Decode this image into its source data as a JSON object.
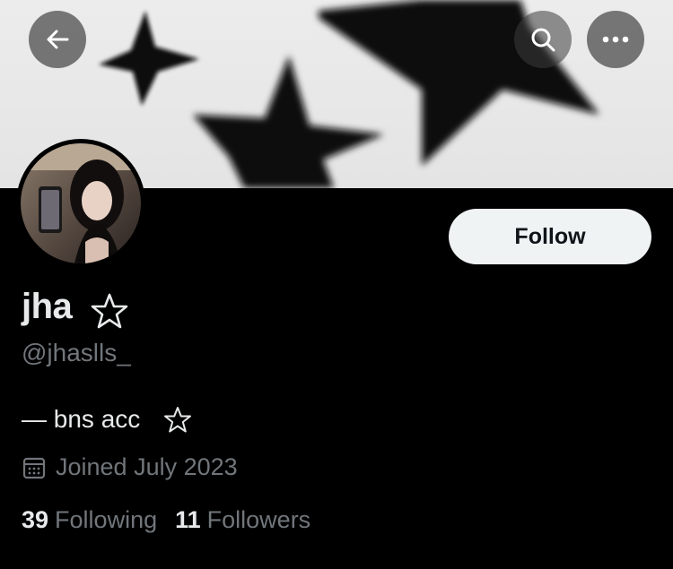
{
  "header": {
    "back_icon": "arrow-left-icon",
    "search_icon": "search-icon",
    "more_icon": "more-horizontal-icon"
  },
  "profile": {
    "display_name": "jha",
    "display_name_symbol": "star-outline-icon",
    "handle": "@jhaslls_",
    "bio": "— bns acc",
    "bio_symbol": "star-outline-icon",
    "joined": "Joined July 2023",
    "following_count": "39",
    "following_label": "Following",
    "followers_count": "11",
    "followers_label": "Followers"
  },
  "actions": {
    "follow_label": "Follow"
  },
  "colors": {
    "background": "#000000",
    "primary_text": "#e7e9ea",
    "secondary_text": "#71767b",
    "follow_button_bg": "#eff3f4",
    "follow_button_text": "#0f1419",
    "banner_bg": "#e8e8e8"
  }
}
